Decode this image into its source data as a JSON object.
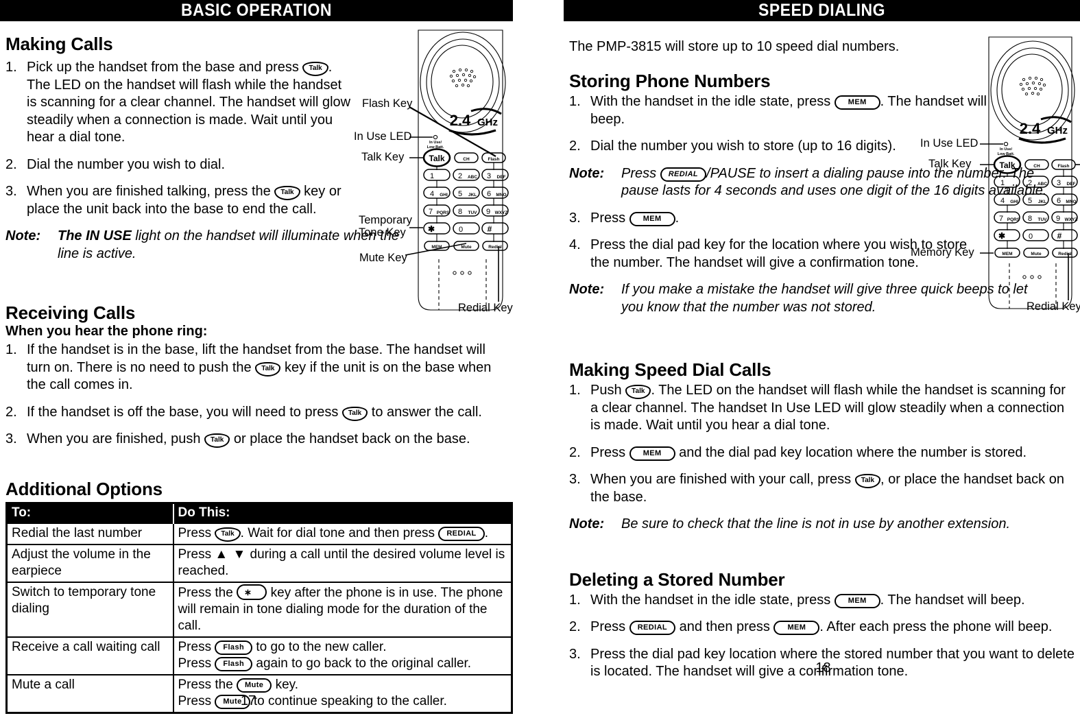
{
  "left_page": {
    "banner": "BASIC OPERATION",
    "page_number": "17",
    "making_calls": {
      "heading": "Making Calls",
      "steps": [
        {
          "num": "1.",
          "parts": [
            "Pick up the handset from the base and press ",
            {
              "key": "Talk",
              "style": "talk"
            },
            ". The LED on the handset will flash while the handset is scanning for a clear channel.  The handset will glow steadily when a connection is made.  Wait until you hear a dial tone."
          ]
        },
        {
          "num": "2.",
          "parts": [
            "Dial the number you wish to dial."
          ]
        },
        {
          "num": "3.",
          "parts": [
            "When you are finished talking, press the ",
            {
              "key": "Talk",
              "style": "talk"
            },
            " key or place the unit back into the base to end the call."
          ]
        }
      ],
      "note_label": "Note:",
      "note_bold": "The IN USE",
      "note_rest": " light on the handset will illuminate when the line is active."
    },
    "receiving_calls": {
      "heading": "Receiving Calls",
      "subheading": "When you hear the phone ring:",
      "steps": [
        {
          "num": "1.",
          "parts": [
            "If the handset is in the base, lift the handset from the base. The handset will turn on.  There is no need to push the ",
            {
              "key": "Talk",
              "style": "talk"
            },
            " key if the unit is on the base when the call comes in."
          ]
        },
        {
          "num": "2.",
          "parts": [
            "If the handset is off the base, you will need to press ",
            {
              "key": "Talk",
              "style": "talk"
            },
            " to answer the call."
          ]
        },
        {
          "num": "3.",
          "parts": [
            "When you are finished, push ",
            {
              "key": "Talk",
              "style": "talk"
            },
            " or place the handset back on the base."
          ]
        }
      ]
    },
    "additional_options": {
      "heading": "Additional Options",
      "col1_header": "To:",
      "col2_header": "Do This:",
      "rows": [
        {
          "to": "Redial the last number",
          "do": [
            "Press ",
            {
              "key": "Talk",
              "style": "talk"
            },
            ".  Wait for dial tone and then press ",
            {
              "key": "REDIAL",
              "style": "pill"
            },
            "."
          ]
        },
        {
          "to": "Adjust the volume in the earpiece",
          "do": [
            "Press ",
            {
              "key": "▲ ▼",
              "style": "arrow"
            },
            " during a call until the desired volume level is reached."
          ]
        },
        {
          "to": "Switch to temporary tone dialing",
          "do": [
            "Press the ",
            {
              "key": "∗",
              "style": "star"
            },
            " key after the phone is in use.  The phone will remain in tone dialing mode for the duration of the call."
          ]
        },
        {
          "to": "Receive a call waiting call",
          "do": [
            "Press ",
            {
              "key": "Flash",
              "style": "pill"
            },
            " to go to the new caller.\nPress ",
            {
              "key": "Flash",
              "style": "pill"
            },
            " again to go back to the original caller."
          ]
        },
        {
          "to": "Mute a call",
          "do": [
            "Press the ",
            {
              "key": "Mute",
              "style": "pill"
            },
            " key.\nPress ",
            {
              "key": "Mute",
              "style": "pill"
            },
            " to continue speaking to the caller."
          ]
        }
      ]
    },
    "diagram": {
      "band_label": "2.4",
      "band_unit": "GHz",
      "led_caption_line1": "In Use/",
      "led_caption_line2": "Low Batt.",
      "callouts": [
        "Flash Key",
        "In Use LED",
        "Talk Key",
        "Temporary",
        "Tone Key",
        "Mute Key",
        "Redial Key"
      ],
      "keypad": {
        "top_row": [
          "Talk",
          "CH",
          "Flash"
        ],
        "digits": [
          [
            "1",
            ""
          ],
          [
            "2",
            "ABC"
          ],
          [
            "3",
            "DEF"
          ],
          [
            "4",
            "GHI"
          ],
          [
            "5",
            "JKL"
          ],
          [
            "6",
            "MNO"
          ],
          [
            "7",
            "PQRS"
          ],
          [
            "8",
            "TUV"
          ],
          [
            "9",
            "WXYZ"
          ],
          [
            "∗",
            ""
          ],
          [
            "0",
            ""
          ],
          [
            "#",
            ""
          ]
        ],
        "bottom_row": [
          "MEM",
          "Mute",
          "Redial"
        ]
      }
    }
  },
  "right_page": {
    "banner": "SPEED DIALING",
    "page_number": "18",
    "intro": "The PMP-3815 will store up to 10 speed dial numbers.",
    "storing": {
      "heading": "Storing Phone Numbers",
      "steps": [
        {
          "num": "1.",
          "parts": [
            "With the handset in the idle state, press ",
            {
              "key": "MEM",
              "style": "pill wide"
            },
            ". The handset will beep."
          ]
        },
        {
          "num": "2.",
          "parts": [
            "Dial the number you wish to store (up to 16 digits)."
          ]
        }
      ],
      "note1_label": "Note:",
      "note1_parts": [
        "Press ",
        {
          "key": "REDIAL",
          "style": "pill"
        },
        "/PAUSE to insert a dialing pause into the number.  The pause lasts for 4 seconds and uses one digit of the 16 digits available."
      ],
      "steps2": [
        {
          "num": "3.",
          "parts": [
            "Press ",
            {
              "key": "MEM",
              "style": "pill wide"
            },
            "."
          ]
        },
        {
          "num": "4.",
          "parts": [
            "Press the dial pad key for the location where you wish to store the number.  The handset will give a confirmation tone."
          ]
        }
      ],
      "note2_label": "Note:",
      "note2_text": "If you make a mistake the handset will give three quick beeps to let you know that the number was not stored."
    },
    "making_speed": {
      "heading": "Making Speed Dial Calls",
      "steps": [
        {
          "num": "1.",
          "parts": [
            "Push ",
            {
              "key": "Talk",
              "style": "talk"
            },
            ".  The LED on the handset will flash while the handset is scanning for a clear channel.  The handset In Use LED will glow steadily when a connection is made.  Wait until you hear a dial tone."
          ]
        },
        {
          "num": "2.",
          "parts": [
            "Press ",
            {
              "key": "MEM",
              "style": "pill wide"
            },
            " and the dial pad key location where the number is stored."
          ]
        },
        {
          "num": "3.",
          "parts": [
            "When you are finished with your call, press ",
            {
              "key": "Talk",
              "style": "talk"
            },
            ", or place the handset back on the base."
          ]
        }
      ],
      "note_label": "Note:",
      "note_text": "Be sure to check that the line is not in use by another extension."
    },
    "deleting": {
      "heading": "Deleting a Stored Number",
      "steps": [
        {
          "num": "1.",
          "parts": [
            "With the handset in the idle state, press ",
            {
              "key": "MEM",
              "style": "pill wide"
            },
            ".  The handset will beep."
          ]
        },
        {
          "num": "2.",
          "parts": [
            "Press ",
            {
              "key": "REDIAL",
              "style": "pill"
            },
            " and then press ",
            {
              "key": "MEM",
              "style": "pill wide"
            },
            ".  After each press the phone will beep."
          ]
        },
        {
          "num": "3.",
          "parts": [
            "Press the dial pad key location where the stored number that you want to delete is located.  The handset will give a confirmation tone."
          ]
        }
      ]
    },
    "diagram": {
      "band_label": "2.4",
      "band_unit": "GHz",
      "led_caption_line1": "In Use/",
      "led_caption_line2": "Low Batt.",
      "callouts": [
        "In Use LED",
        "Talk Key",
        "Memory Key",
        "Redial Key"
      ],
      "keypad": {
        "top_row": [
          "Talk",
          "CH",
          "Flash"
        ],
        "digits": [
          [
            "1",
            ""
          ],
          [
            "2",
            "ABC"
          ],
          [
            "3",
            "DEF"
          ],
          [
            "4",
            "GHI"
          ],
          [
            "5",
            "JKL"
          ],
          [
            "6",
            "MNO"
          ],
          [
            "7",
            "PQRS"
          ],
          [
            "8",
            "TUV"
          ],
          [
            "9",
            "WXYZ"
          ],
          [
            "∗",
            ""
          ],
          [
            "0",
            ""
          ],
          [
            "#",
            ""
          ]
        ],
        "bottom_row": [
          "MEM",
          "Mute",
          "Redial"
        ]
      }
    }
  }
}
